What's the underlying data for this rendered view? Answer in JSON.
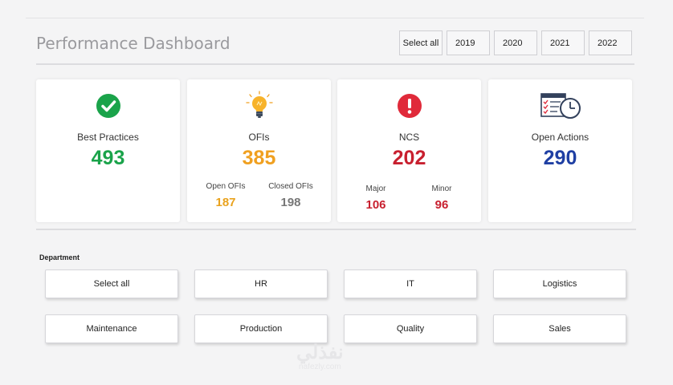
{
  "title": "Performance Dashboard",
  "year_filter": {
    "select_all": "Select all",
    "years": [
      "2019",
      "2020",
      "2021",
      "2022"
    ]
  },
  "cards": {
    "best_practices": {
      "label": "Best Practices",
      "value": "493",
      "color": "#1aa34a",
      "icon": "check-circle-icon"
    },
    "ofis": {
      "label": "OFIs",
      "value": "385",
      "color": "#f0a020",
      "icon": "lightbulb-icon",
      "open_label": "Open OFIs",
      "open_value": "187",
      "closed_label": "Closed OFIs",
      "closed_value": "198"
    },
    "ncs": {
      "label": "NCS",
      "value": "202",
      "color": "#c8202f",
      "icon": "exclamation-circle-icon",
      "major_label": "Major",
      "major_value": "106",
      "minor_label": "Minor",
      "minor_value": "96"
    },
    "open_actions": {
      "label": "Open Actions",
      "value": "290",
      "color": "#1f3fa3",
      "icon": "checklist-clock-icon"
    }
  },
  "department": {
    "label": "Department",
    "buttons": [
      "Select all",
      "HR",
      "IT",
      "Logistics",
      "Maintenance",
      "Production",
      "Quality",
      "Sales"
    ]
  },
  "watermark": {
    "arabic": "نفذلي",
    "latin": "nafezly.com"
  }
}
